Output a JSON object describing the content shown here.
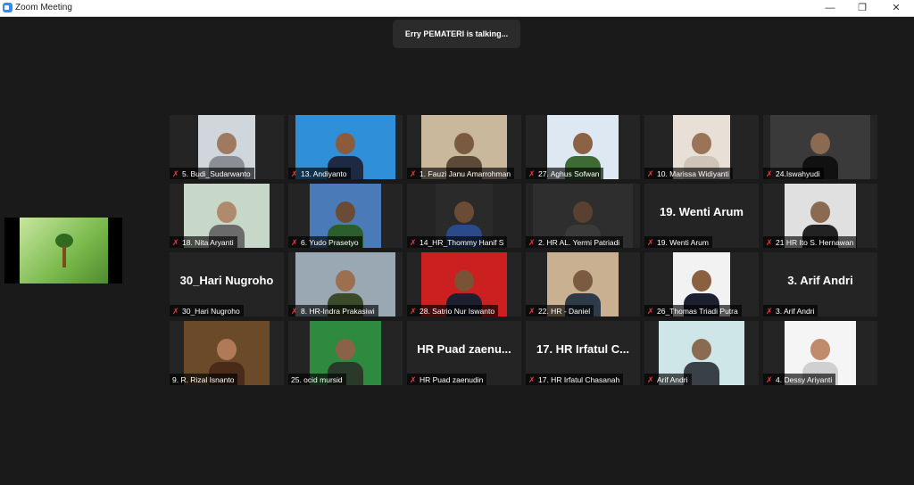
{
  "window": {
    "title": "Zoom Meeting",
    "minimize": "—",
    "restore": "❐",
    "close": "✕"
  },
  "talking": "Erry PEMATERI is talking...",
  "participants": [
    {
      "label": "5. Budi_Sudarwanto",
      "muted": true
    },
    {
      "label": "13. Andiyanto",
      "muted": true
    },
    {
      "label": "1. Fauzi Janu Amarrohman",
      "muted": true
    },
    {
      "label": "27. Aghus Sofwan",
      "muted": true
    },
    {
      "label": "10. Marissa Widiyanti",
      "muted": true
    },
    {
      "label": "24.Iswahyudi",
      "muted": true
    },
    {
      "label": "18. Nita Aryanti",
      "muted": true
    },
    {
      "label": "6. Yudo Prasetyo",
      "muted": true
    },
    {
      "label": "14_HR_Thommy Hanif S",
      "muted": true
    },
    {
      "label": "2. HR AL. Yermi Patriadi",
      "muted": true
    },
    {
      "label": "19. Wenti Arum",
      "muted": true,
      "big": "19. Wenti Arum"
    },
    {
      "label": "21 HR Ito S. Hernawan",
      "muted": true
    },
    {
      "label": "30_Hari Nugroho",
      "muted": true,
      "big": "30_Hari Nugroho"
    },
    {
      "label": "8. HR-Indra Prakasiwi",
      "muted": true
    },
    {
      "label": "28. Satrio Nur Iswanto",
      "muted": true
    },
    {
      "label": "22. HR - Daniel",
      "muted": true
    },
    {
      "label": "26_Thomas Triadi Putra",
      "muted": true
    },
    {
      "label": "3.  Arif Andri",
      "muted": true,
      "big": "3.  Arif Andri"
    },
    {
      "label": "9. R. Rizal Isnanto",
      "muted": false
    },
    {
      "label": "25. ocid mursid",
      "muted": false
    },
    {
      "label": "HR Puad zaenudin",
      "muted": true,
      "big": "HR Puad zaenu..."
    },
    {
      "label": "17. HR Irfatul Chasanah",
      "muted": true,
      "big": "17. HR Irfatul C..."
    },
    {
      "label": "Arif Andri",
      "muted": true
    },
    {
      "label": "4. Dessy Ariyanti",
      "muted": true
    }
  ],
  "icons": {
    "muted": "mic-muted-icon"
  },
  "colors": {
    "mic_muted": "#e23b3b",
    "talking_bg": "#2b2b2b",
    "background": "#1a1a1a"
  }
}
